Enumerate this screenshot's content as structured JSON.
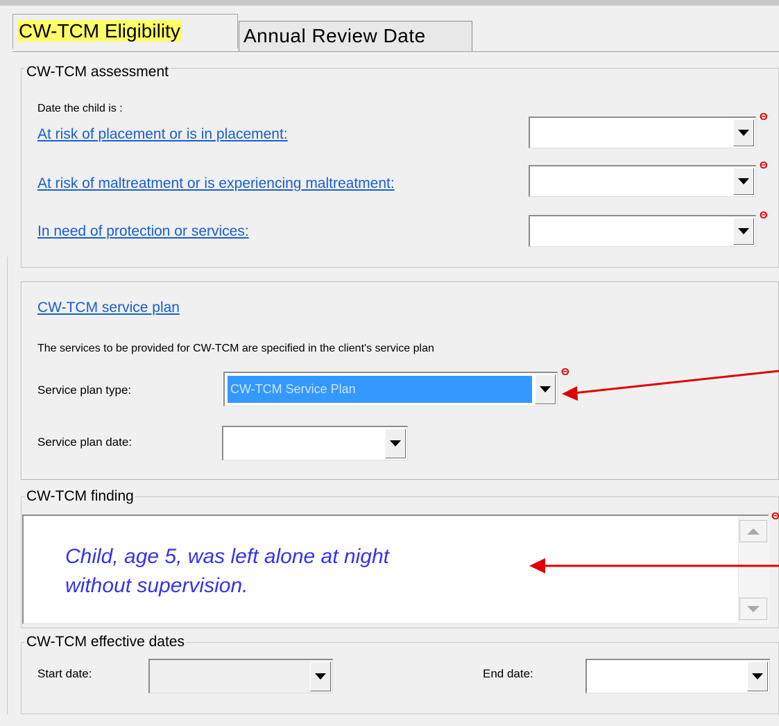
{
  "tabs": {
    "eligibility": "CW-TCM Eligibility",
    "annual_review": "Annual Review Date"
  },
  "assessment": {
    "legend": "CW-TCM assessment",
    "intro": "Date the child is :",
    "rows": [
      {
        "label": "At risk of placement or is in placement:",
        "value": "",
        "required_icon": "required-marker-icon"
      },
      {
        "label": "At risk of maltreatment or is experiencing maltreatment:",
        "value": "",
        "required_icon": "required-marker-icon"
      },
      {
        "label": "In need of protection or services:",
        "value": "",
        "required_icon": "required-marker-icon"
      }
    ]
  },
  "service_plan": {
    "title": "CW-TCM service plan",
    "description": "The services to be provided for CW-TCM are specified in the client's service plan",
    "type_label": "Service plan type:",
    "type_value": "CW-TCM Service Plan",
    "date_label": "Service plan date:",
    "date_value": ""
  },
  "finding": {
    "legend": "CW-TCM finding",
    "line1": "Child, age 5, was left alone at night",
    "line2": "without supervision."
  },
  "effective_dates": {
    "legend": "CW-TCM effective dates",
    "start_label": "Start date:",
    "start_value": "",
    "end_label": "End date:",
    "end_value": ""
  },
  "required_marker": "Θ",
  "colors": {
    "link": "#1a5fd0",
    "required": "#e00000",
    "selection": "#3399ff",
    "tab_highlight": "#ffff66",
    "annotation_arrow": "#e00000",
    "finding_text": "#3333ee"
  }
}
